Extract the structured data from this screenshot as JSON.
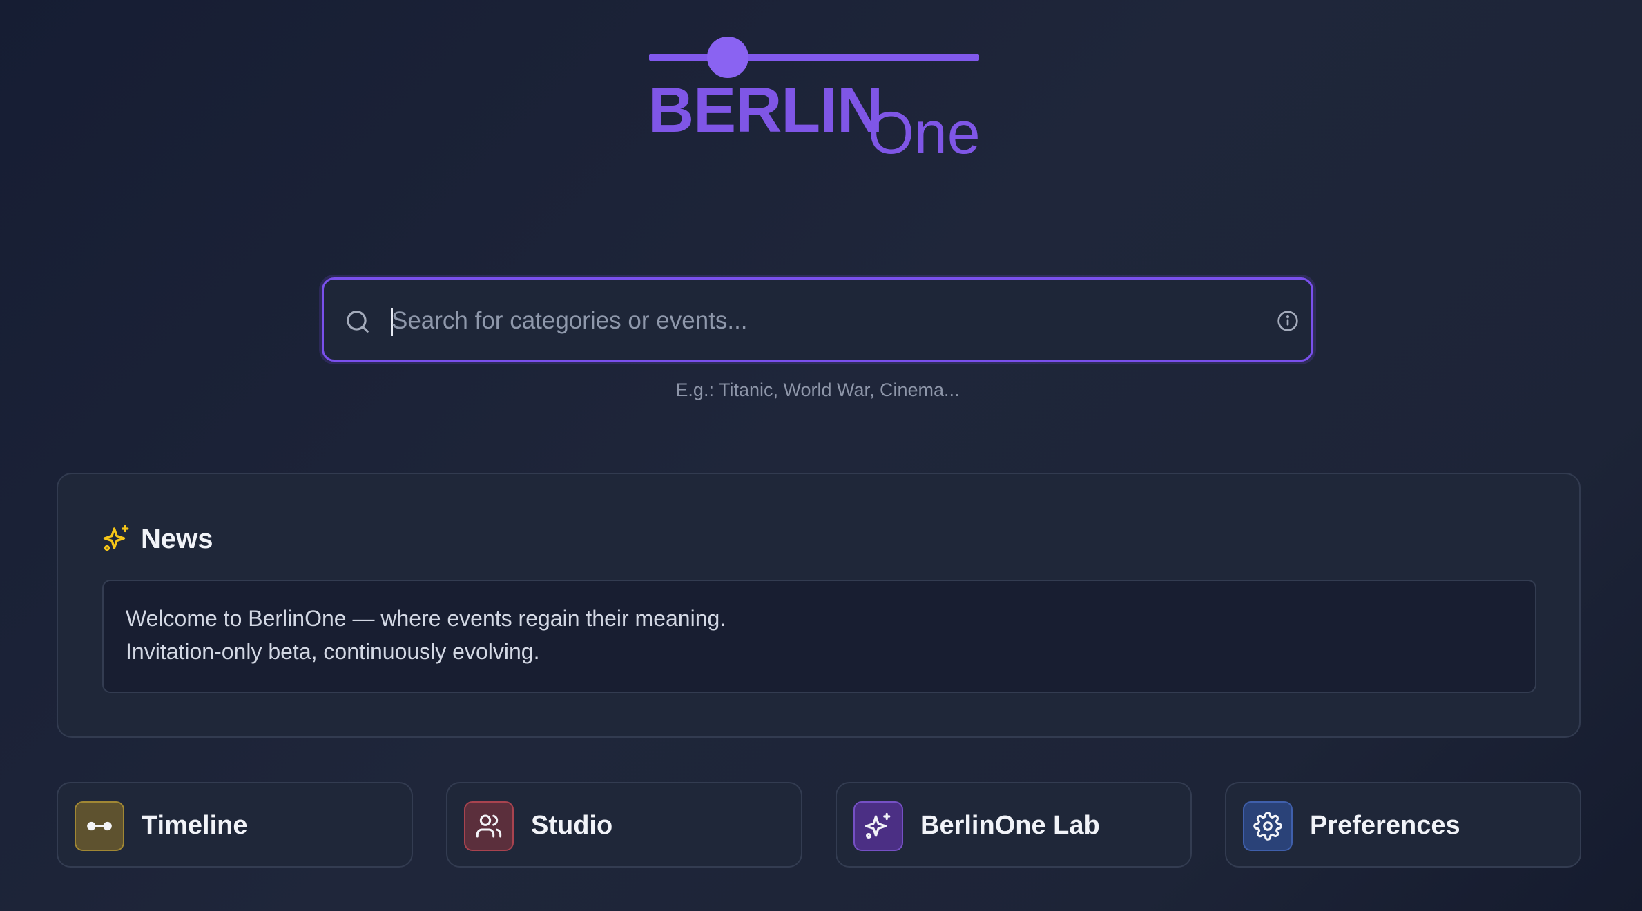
{
  "logo": {
    "primary": "BERLIN",
    "secondary": "One",
    "color": "#7f56e6"
  },
  "search": {
    "value": "",
    "placeholder": "Search for categories or events...",
    "hint": "E.g.: Titanic, World War, Cinema...",
    "accent": "#7a50ec",
    "icon": "search-icon",
    "info_icon": "info-icon"
  },
  "news": {
    "title": "News",
    "icon": "sparkles-icon",
    "icon_color": "#f5c518",
    "lines": [
      "Welcome to BerlinOne — where events regain their meaning.",
      "Invitation-only beta, continuously evolving."
    ]
  },
  "actions": [
    {
      "label": "Timeline",
      "icon": "timeline-icon",
      "color": "#a08734"
    },
    {
      "label": "Studio",
      "icon": "users-icon",
      "color": "#a8434f"
    },
    {
      "label": "BerlinOne Lab",
      "icon": "sparkles-icon",
      "color": "#7550c4"
    },
    {
      "label": "Preferences",
      "icon": "gear-icon",
      "color": "#3f5fab"
    }
  ]
}
